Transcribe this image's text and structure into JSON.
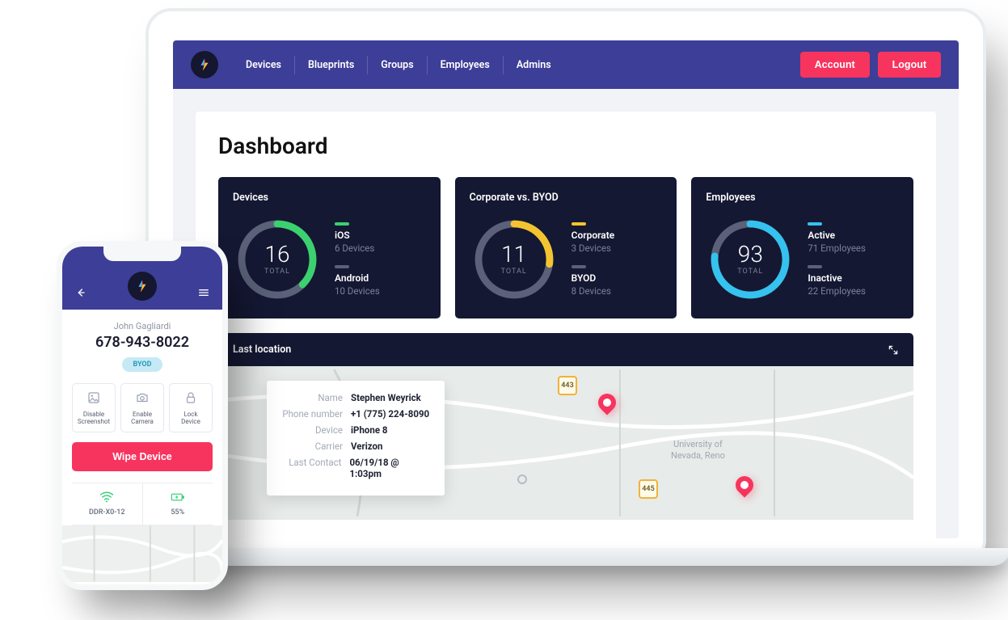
{
  "nav": {
    "links": [
      "Devices",
      "Blueprints",
      "Groups",
      "Employees",
      "Admins"
    ],
    "account_label": "Account",
    "logout_label": "Logout"
  },
  "dashboard": {
    "title": "Dashboard",
    "cards": [
      {
        "title": "Devices",
        "total": "16",
        "total_label": "TOTAL",
        "legend": [
          {
            "name": "iOS",
            "sub": "6 Devices",
            "color": "#3bd16f"
          },
          {
            "name": "Android",
            "sub": "10 Devices",
            "color": "#5a6178"
          }
        ]
      },
      {
        "title": "Corporate vs. BYOD",
        "total": "11",
        "total_label": "TOTAL",
        "legend": [
          {
            "name": "Corporate",
            "sub": "3 Devices",
            "color": "#f4c430"
          },
          {
            "name": "BYOD",
            "sub": "8 Devices",
            "color": "#5a6178"
          }
        ]
      },
      {
        "title": "Employees",
        "total": "93",
        "total_label": "TOTAL",
        "legend": [
          {
            "name": "Active",
            "sub": "71 Employees",
            "color": "#35c2ee"
          },
          {
            "name": "Inactive",
            "sub": "22 Employees",
            "color": "#5a6178"
          }
        ]
      }
    ],
    "map": {
      "title": "Last location",
      "info": {
        "labels": {
          "name": "Name",
          "phone": "Phone number",
          "device": "Device",
          "carrier": "Carrier",
          "last": "Last Contact"
        },
        "name": "Stephen Weyrick",
        "phone": "+1 (775) 224-8090",
        "device": "iPhone 8",
        "carrier": "Verizon",
        "last": "06/19/18 @ 1:03pm"
      },
      "place_label": "University of\nNevada, Reno",
      "routes": [
        "443",
        "445"
      ]
    }
  },
  "phone": {
    "user_name": "John Gagliardi",
    "user_phone": "678-943-8022",
    "badge": "BYOD",
    "actions": [
      {
        "label": "Disable\nScreenshot"
      },
      {
        "label": "Enable\nCamera"
      },
      {
        "label": "Lock\nDevice"
      }
    ],
    "wipe_label": "Wipe Device",
    "wifi_ssid": "DDR-X0-12",
    "battery": "55%"
  },
  "colors": {
    "accent": "#f7345e",
    "navy": "#151833",
    "header": "#3d3e97"
  },
  "chart_data": [
    {
      "type": "pie",
      "title": "Devices",
      "categories": [
        "iOS",
        "Android"
      ],
      "values": [
        6,
        10
      ]
    },
    {
      "type": "pie",
      "title": "Corporate vs. BYOD",
      "categories": [
        "Corporate",
        "BYOD"
      ],
      "values": [
        3,
        8
      ]
    },
    {
      "type": "pie",
      "title": "Employees",
      "categories": [
        "Active",
        "Inactive"
      ],
      "values": [
        71,
        22
      ]
    }
  ]
}
